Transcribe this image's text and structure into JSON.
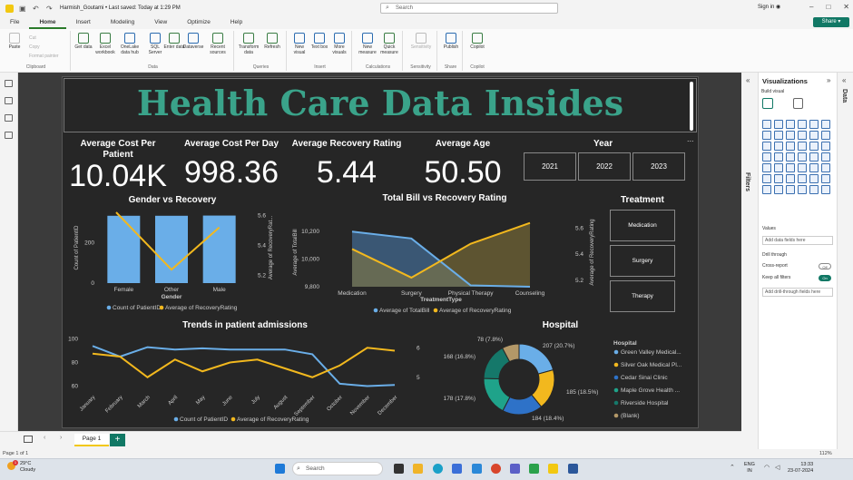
{
  "titlebar": {
    "doc_title": "Harmish_Goutami • Last saved: Today at 1:29 PM",
    "search_placeholder": "Search",
    "signin": "Sign in"
  },
  "menu": [
    "File",
    "Home",
    "Insert",
    "Modeling",
    "View",
    "Optimize",
    "Help"
  ],
  "share_label": "Share",
  "ribbon": {
    "clipboard": {
      "paste": "Paste",
      "cut": "Cut",
      "copy": "Copy",
      "format_painter": "Format painter",
      "label": "Clipboard"
    },
    "data": {
      "get_data": "Get data",
      "excel": "Excel workbook",
      "onelake": "OneLake data hub",
      "sql": "SQL Server",
      "enter": "Enter data",
      "dataverse": "Dataverse",
      "recent": "Recent sources",
      "label": "Data"
    },
    "queries": {
      "transform": "Transform data",
      "refresh": "Refresh",
      "label": "Queries"
    },
    "insert": {
      "new_visual": "New visual",
      "text_box": "Text box",
      "more_visuals": "More visuals",
      "label": "Insert"
    },
    "calculations": {
      "new_measure": "New measure",
      "quick_measure": "Quick measure",
      "label": "Calculations"
    },
    "sensitivity": {
      "sensitivity": "Sensitivity",
      "label": "Sensitivity"
    },
    "share": {
      "publish": "Publish",
      "label": "Share"
    },
    "copilot": {
      "copilot": "Copilot",
      "label": "Copilot"
    }
  },
  "report": {
    "title": "Health Care Data Insides",
    "kpis": [
      {
        "label": "Average Cost Per Patient",
        "value": "10.04K"
      },
      {
        "label": "Average Cost Per Day",
        "value": "998.36"
      },
      {
        "label": "Average Recovery Rating",
        "value": "5.44"
      },
      {
        "label": "Average Age",
        "value": "50.50"
      }
    ],
    "year_slicer": {
      "label": "Year",
      "options": [
        "2021",
        "2022",
        "2023"
      ]
    },
    "treatment_slicer": {
      "label": "Treatment",
      "options": [
        "Medication",
        "Surgery",
        "Therapy"
      ]
    },
    "more_options": "...",
    "colors": {
      "title": "#3aa38a",
      "series_blue": "#6aaee8",
      "series_yellow": "#f2b81e",
      "area_blue": "#4a7fb5",
      "area_yellow": "#8a7a3a"
    }
  },
  "chart_data": [
    {
      "type": "bar",
      "title": "Gender vs Recovery",
      "categories": [
        "Female",
        "Other",
        "Male"
      ],
      "xlabel": "Gender",
      "ylabel": "Count of PatientID",
      "y2label": "Average of RecoveryRat...",
      "series": [
        {
          "name": "Count of PatientID",
          "type": "bar",
          "values": [
            333,
            333,
            334
          ]
        },
        {
          "name": "Average of RecoveryRating",
          "type": "line",
          "axis": "secondary",
          "values": [
            5.62,
            5.24,
            5.52
          ]
        }
      ],
      "ylim": [
        0,
        350
      ],
      "y2lim": [
        5.15,
        5.62
      ],
      "yticks": [
        0,
        200
      ],
      "y2ticks": [
        5.2,
        5.4,
        5.6
      ],
      "legend": "bottom"
    },
    {
      "type": "area",
      "title": "Total Bill vs Recovery Rating",
      "categories": [
        "Medication",
        "Surgery",
        "Physical Therapy",
        "Counseling"
      ],
      "xlabel": "TreatmentType",
      "ylabel": "Average of TotalBill",
      "y2label": "Average of RecoveryRating",
      "series": [
        {
          "name": "Average of TotalBill",
          "values": [
            10200,
            10150,
            9810,
            9800
          ]
        },
        {
          "name": "Average of RecoveryRating",
          "axis": "secondary",
          "values": [
            5.44,
            5.22,
            5.48,
            5.64
          ]
        }
      ],
      "ylim": [
        9800,
        10300
      ],
      "y2lim": [
        5.15,
        5.68
      ],
      "yticks": [
        9800,
        10000,
        10200
      ],
      "ytick_labels": [
        "9,800",
        "10,000",
        "10,200"
      ],
      "y2ticks": [
        5.2,
        5.4,
        5.6
      ],
      "legend": "bottom"
    },
    {
      "type": "line",
      "title": "Trends in patient admissions",
      "categories": [
        "January",
        "February",
        "March",
        "April",
        "May",
        "June",
        "July",
        "August",
        "September",
        "October",
        "November",
        "December"
      ],
      "series": [
        {
          "name": "Count of PatientID",
          "values": [
            94,
            85,
            93,
            91,
            92,
            91,
            91,
            91,
            87,
            62,
            60,
            61
          ]
        },
        {
          "name": "Average of RecoveryRating",
          "axis": "secondary",
          "values": [
            5.8,
            5.7,
            5.0,
            5.6,
            5.2,
            5.5,
            5.6,
            5.3,
            5.0,
            5.4,
            6.0,
            5.9
          ]
        }
      ],
      "ylim": [
        55,
        105
      ],
      "y2lim": [
        4.5,
        6.5
      ],
      "yticks": [
        60,
        80,
        100
      ],
      "y2ticks": [
        5,
        6
      ],
      "legend": "bottom"
    },
    {
      "type": "pie",
      "title": "Hospital",
      "legend_title": "Hospital",
      "slices": [
        {
          "name": "Green Valley Medical...",
          "value": 207,
          "label": "207 (20.7%)",
          "color": "#6aaee8"
        },
        {
          "name": "Silver Oak Medical Pl...",
          "value": 185,
          "label": "185 (18.5%)",
          "color": "#f2b81e"
        },
        {
          "name": "Cedar Sinai Clinic",
          "value": 184,
          "label": "184 (18.4%)",
          "color": "#2e72c8"
        },
        {
          "name": "Maple Grove Health ...",
          "value": 178,
          "label": "178 (17.8%)",
          "color": "#1fa38a"
        },
        {
          "name": "Riverside Hospital",
          "value": 168,
          "label": "168 (16.8%)",
          "color": "#15786a"
        },
        {
          "name": "(Blank)",
          "value": 78,
          "label": "78 (7.8%)",
          "color": "#b39868"
        }
      ],
      "legend": "right"
    }
  ],
  "visualizations": {
    "title": "Visualizations",
    "build_visual": "Build visual",
    "values_label": "Values",
    "values_placeholder": "Add data fields here",
    "drill_label": "Drill through",
    "cross_report": "Cross-report",
    "cross_report_state": "Off",
    "keep_filters": "Keep all filters",
    "keep_filters_state": "On",
    "drill_placeholder": "Add drill-through fields here",
    "filters_tab": "Filters",
    "data_tab": "Data"
  },
  "pages": {
    "tab": "Page 1",
    "status": "Page 1 of 1",
    "zoom": "112%"
  },
  "taskbar": {
    "temp": "29°C",
    "weather": "Cloudy",
    "search": "Search",
    "lang1": "ENG",
    "lang2": "IN",
    "time": "13:33",
    "date": "23-07-2024",
    "badge": "1"
  }
}
